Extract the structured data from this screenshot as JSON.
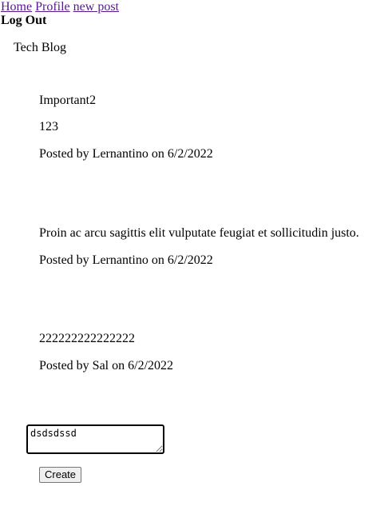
{
  "nav": {
    "home_label": "Home",
    "profile_label": "Profile",
    "new_post_label": "new post",
    "logout_label": "Log Out"
  },
  "site_title": "Tech Blog",
  "posts": [
    {
      "title": "Important2",
      "content": "123",
      "byline": "Posted by Lernantino on 6/2/2022"
    },
    {
      "title": "",
      "content": "Proin ac arcu sagittis elit vulputate feugiat et sollicitudin justo.",
      "byline": "Posted by Lernantino on 6/2/2022"
    },
    {
      "title": "",
      "content": "222222222222222",
      "byline": "Posted by Sal on 6/2/2022"
    }
  ],
  "comment_form": {
    "input_value": "dsdsdssd",
    "submit_label": "Create"
  }
}
